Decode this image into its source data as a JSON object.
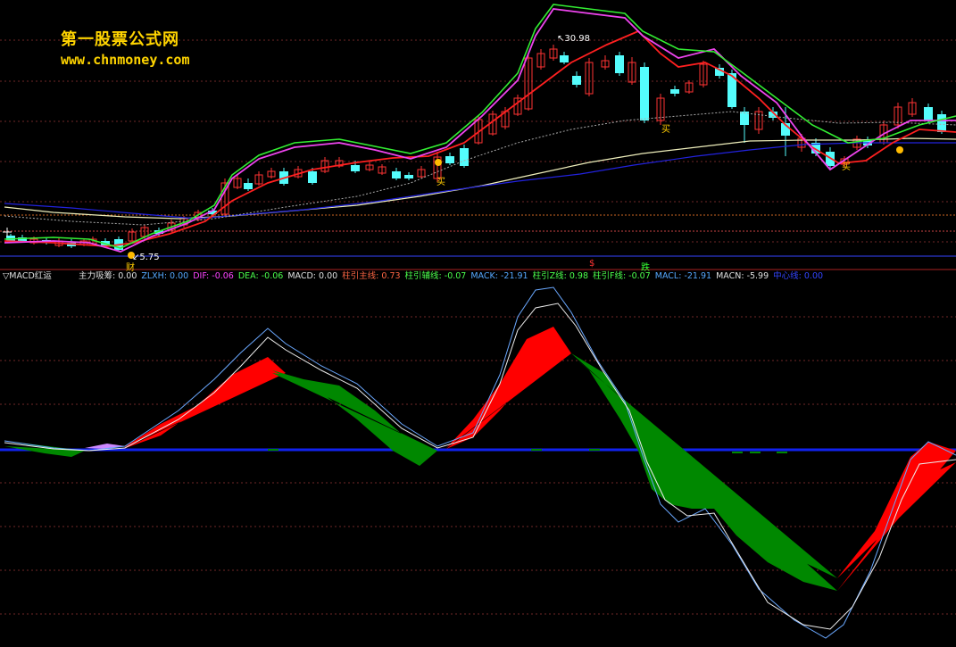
{
  "watermark": {
    "title": "第一股票公式网",
    "url": "www.chnmoney.com"
  },
  "price_panel": {
    "high_label": "30.98",
    "low_label": "5.75",
    "markers": {
      "buy": "买",
      "caution": "财",
      "down": "跌",
      "dollar": "$"
    }
  },
  "indicator": {
    "name": "▽MACD红运",
    "items": [
      {
        "label": "主力吸筹: 0.00",
        "color": "#e0e0e0"
      },
      {
        "label": "ZLXH: 0.00",
        "color": "#56a8ff"
      },
      {
        "label": "DIF: -0.06",
        "color": "#ff44ff"
      },
      {
        "label": "DEA: -0.06",
        "color": "#4cff4c"
      },
      {
        "label": "MACD: 0.00",
        "color": "#e0e0e0"
      },
      {
        "label": "柱引主线: 0.73",
        "color": "#ff6644"
      },
      {
        "label": "柱引辅线: -0.07",
        "color": "#4cff4c"
      },
      {
        "label": "MACK: -21.91",
        "color": "#56a8ff"
      },
      {
        "label": "柱引Z线: 0.98",
        "color": "#4cff4c"
      },
      {
        "label": "柱引F线: -0.07",
        "color": "#4cff4c"
      },
      {
        "label": "MACL: -21.91",
        "color": "#56a8ff"
      },
      {
        "label": "MACN: -5.99",
        "color": "#e0e0e0"
      },
      {
        "label": "中心线: 0.00",
        "color": "#3344ff"
      }
    ]
  },
  "colors": {
    "bull": "#ff3333",
    "bear": "#54fcfc",
    "ma_red": "#ff2020",
    "ma_magenta": "#ee44ee",
    "ma_green": "#33ee33",
    "ma_white": "#eeeebb",
    "ma_blue": "#2222dd",
    "macd_red": "#ff0000",
    "macd_green": "#008800"
  }
}
